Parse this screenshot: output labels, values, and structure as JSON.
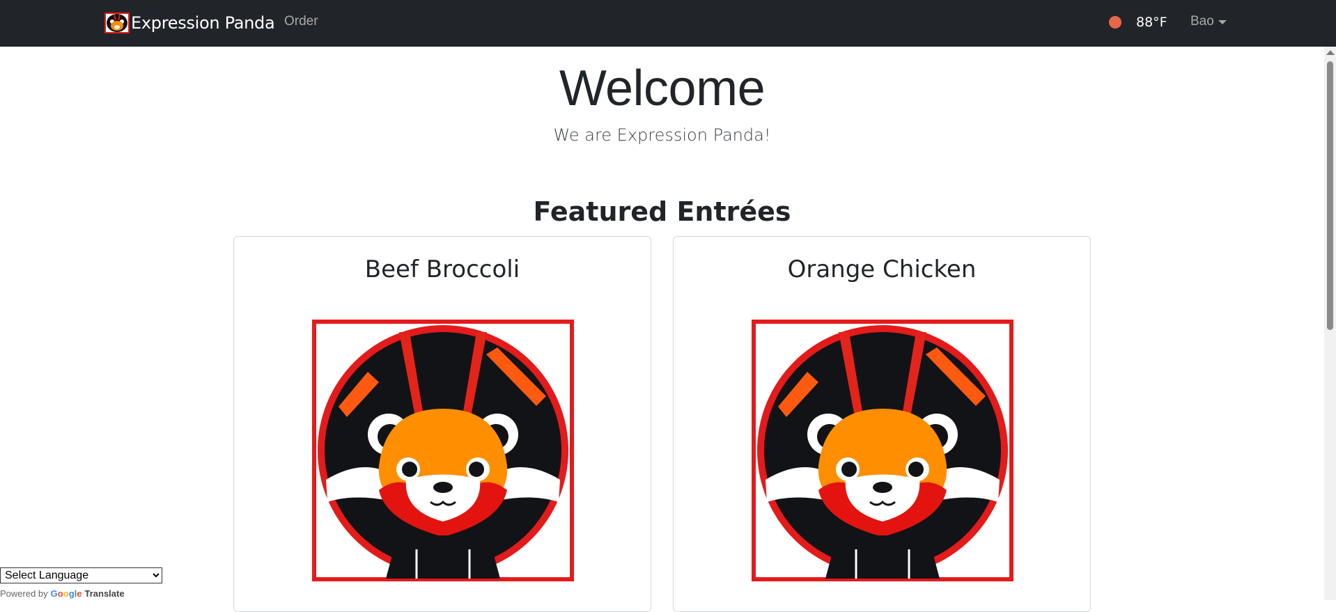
{
  "navbar": {
    "brand": "Expression Panda",
    "links": [
      {
        "label": "Order"
      }
    ],
    "weather": {
      "temperature": "88°F",
      "indicator_color": "#e8674a"
    },
    "user": {
      "name": "Bao"
    }
  },
  "hero": {
    "title": "Welcome",
    "subtitle": "We are Expression Panda!"
  },
  "featured": {
    "heading": "Featured Entrées",
    "items": [
      {
        "name": "Beef Broccoli",
        "image_icon": "red-panda-logo"
      },
      {
        "name": "Orange Chicken",
        "image_icon": "red-panda-logo"
      }
    ]
  },
  "translate": {
    "select_value": "Select Language",
    "powered_by": "Powered by",
    "google": "Google",
    "translate": "Translate"
  },
  "colors": {
    "navbar_bg": "#212529",
    "logo_red": "#e31b1b",
    "logo_orange": "#ff8a00"
  }
}
